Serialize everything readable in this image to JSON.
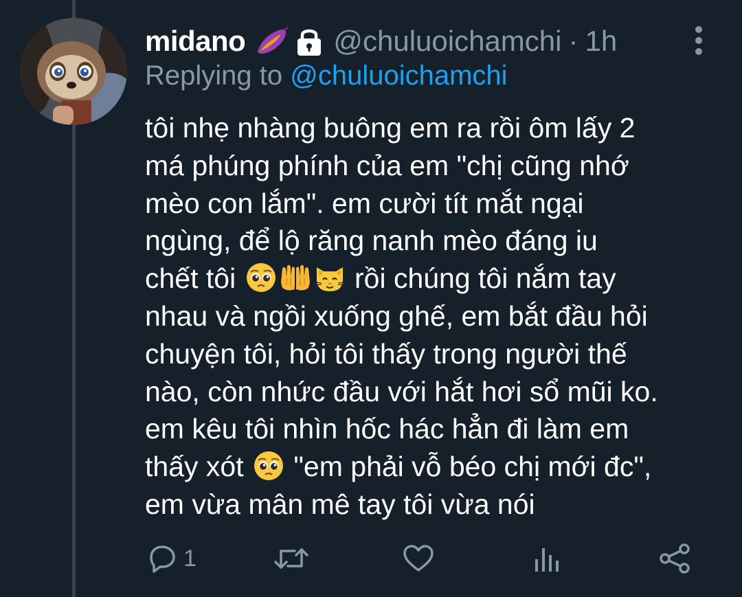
{
  "tweet": {
    "display_name": "midano",
    "handle": "@chuluoichamchi",
    "separator": "·",
    "time": "1h",
    "replying_prefix": "Replying to",
    "replying_to": "@chuluoichamchi",
    "name_emoji": "sweet-potato-emoji",
    "protected_icon": "lock-icon",
    "body": {
      "l1": "tôi nhẹ nhàng buông em ra rồi ôm lấy 2",
      "l2": "má phúng phính của em \"chị cũng nhớ",
      "l3": "mèo con lắm\". em cười tít mắt ngại",
      "l4": "ngùng, để lộ răng nanh mèo đáng iu",
      "l5a": "chết tôi ",
      "l5b": " rồi chúng tôi nắm tay",
      "l6": "nhau và ngồi xuống ghế, em bắt đầu hỏi",
      "l7": "chuyện tôi, hỏi tôi thấy trong người thế",
      "l8": "nào, còn nhức đầu với hắt hơi sổ mũi ko.",
      "l9": "em kêu tôi nhìn hốc hác hẳn đi làm em",
      "l10a": "thấy xót ",
      "l10b": " \"em phải vỗ béo chị mới đc\",",
      "l11": "em vừa mân mê tay tôi vừa nói"
    },
    "inline_emojis": [
      "pleading-face-emoji",
      "palms-up-together-emoji",
      "cat-face-emoji",
      "pleading-face-emoji"
    ],
    "actions": {
      "reply_count": "1",
      "icons": [
        "reply-icon",
        "retweet-icon",
        "like-icon",
        "analytics-icon",
        "share-icon"
      ]
    }
  },
  "colors": {
    "background": "#15202b",
    "text": "#ffffff",
    "secondary": "#8899a6",
    "link": "#1da1f2",
    "thread_line": "#38444d"
  }
}
